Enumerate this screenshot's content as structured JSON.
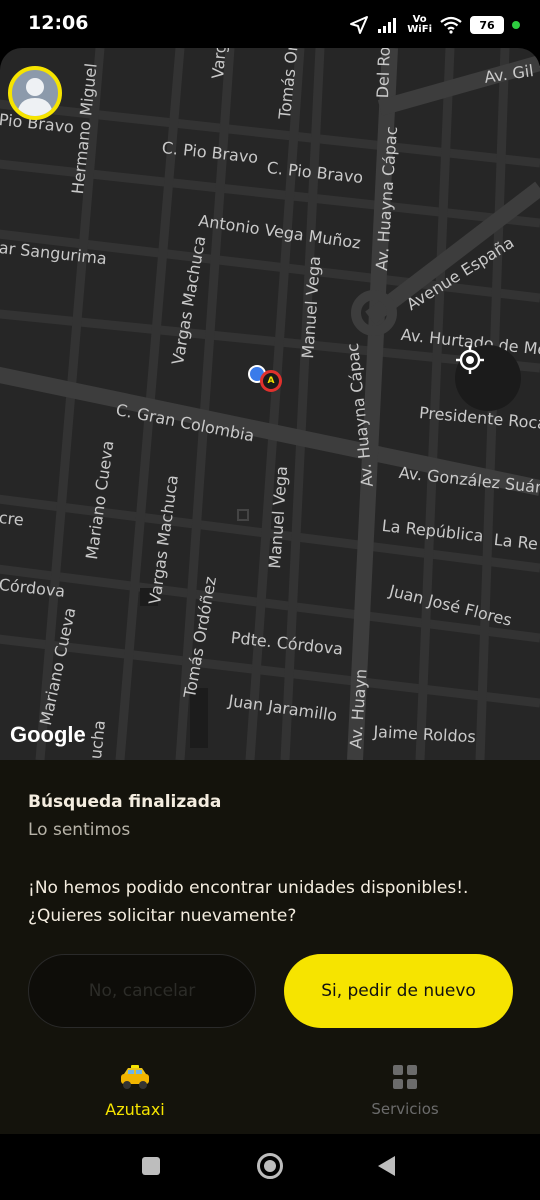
{
  "status_bar": {
    "time": "12:06",
    "network_label_top": "Vo",
    "network_label_bottom": "WiFi",
    "battery": "76",
    "icons": [
      "navigation-arrow-icon",
      "signal-icon",
      "signal-icon",
      "wifi-icon",
      "battery-icon"
    ]
  },
  "map": {
    "attribution": "Google",
    "streets": [
      "Av. Gil F",
      "Del Ro",
      "Tomás Or",
      "Varg",
      "Hermano Miguel",
      "Pio Bravo",
      "C. Pio Bravo",
      "C. Pio Bravo",
      "Av. Huayna Cápac",
      "Antonio Vega Muñoz",
      "ar Sangurima",
      "Avenue España",
      "Vargas Machuca",
      "Manuel Vega",
      "Av. Hurtado de Me",
      "Av. Huayna Cápac",
      "C. Gran Colombia",
      "Presidente Roca",
      "Mariano Cueva",
      "Av. González Suáre",
      "Vargas Machuca",
      "cre",
      "Manuel Vega",
      "La República",
      "La Re",
      "Córdova",
      "Tomás Ordóñez",
      "Juan José Flores",
      "Pdte. Córdova",
      "Mariano Cueva",
      "Juan Jaramillo",
      "Av. Huayn",
      "Jaime Roldos",
      "ucha"
    ],
    "pickup_marker_letter": "A"
  },
  "panel": {
    "title": "Búsqueda finalizada",
    "subtitle": "Lo sentimos",
    "message_line1": "¡No hemos podido encontrar unidades disponibles!.",
    "message_line2": "¿Quieres solicitar nuevamente?",
    "cancel_label": "No, cancelar",
    "retry_label": "Si, pedir de nuevo"
  },
  "tabs": [
    {
      "label": "Azutaxi",
      "icon": "taxi-icon",
      "active": true
    },
    {
      "label": "Servicios",
      "icon": "grid-icon",
      "active": false
    }
  ],
  "colors": {
    "accent": "#f6e400",
    "map_background": "#262626",
    "panel_background": "#14130c",
    "user_location": "#3a7bea",
    "pickup_ring": "#e0312d"
  }
}
